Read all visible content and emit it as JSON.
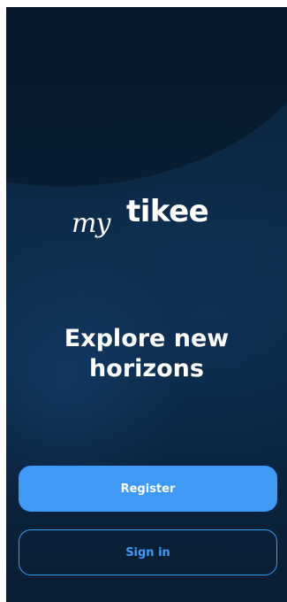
{
  "logo": {
    "script": "my",
    "word": "tikee"
  },
  "headline": {
    "line1": "Explore new",
    "line2": "horizons"
  },
  "buttons": {
    "register_label": "Register",
    "signin_label": "Sign in"
  },
  "colors": {
    "accent": "#3f9af7",
    "background_top": "#0b2239",
    "background_bottom": "#091d33"
  }
}
